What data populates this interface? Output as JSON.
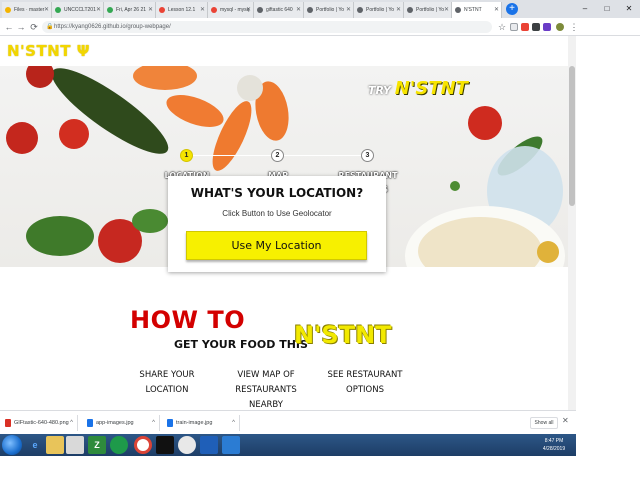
{
  "browser": {
    "tabs": [
      {
        "label": "Files · master",
        "color": "#f4b400"
      },
      {
        "label": "UNCCCLT201",
        "color": "#34a853"
      },
      {
        "label": "Fri, Apr 26 21",
        "color": "#34a853"
      },
      {
        "label": "Lesson 12.1",
        "color": "#ea4335"
      },
      {
        "label": "mysql - mysq",
        "color": "#ea4335"
      },
      {
        "label": "giftastic 640",
        "color": "#5f6368"
      },
      {
        "label": "Portfolio | Yo",
        "color": "#5f6368"
      },
      {
        "label": "Portfolio | Yo",
        "color": "#5f6368"
      },
      {
        "label": "Portfolio | Yo",
        "color": "#5f6368"
      },
      {
        "label": "N'STNT",
        "color": "#5f6368"
      }
    ],
    "new_tab_label": "+",
    "url": "https://kyang0626.github.io/group-webpage/",
    "window_controls": {
      "minimize": "–",
      "maximize": "□",
      "close": "✕"
    }
  },
  "site": {
    "logo": "N'STNT",
    "hero": {
      "try_word": "TRY",
      "brand": "N'STNT",
      "steps": [
        {
          "number": "1",
          "label": "LOCATION"
        },
        {
          "number": "2",
          "label": "MAP"
        },
        {
          "number": "3",
          "label": "RESTAURANT\nOPTIONS"
        }
      ],
      "card": {
        "title": "WHAT'S YOUR LOCATION?",
        "subtitle": "Click Button to Use Geolocator",
        "button": "Use My Location"
      }
    },
    "howto": {
      "heading": "HOW TO",
      "subheading": "GET YOUR FOOD THIS",
      "brand": "N'STNT",
      "columns": [
        "SHARE YOUR\nLOCATION",
        "VIEW MAP OF\nRESTAURANTS\nNEARBY",
        "SEE RESTAURANT\nOPTIONS"
      ]
    }
  },
  "downloads": {
    "items": [
      {
        "label": "GIFtastic-640-480.png"
      },
      {
        "label": "app-images.jpg"
      },
      {
        "label": "train-image.jpg"
      }
    ],
    "show_all": "Show all",
    "close": "✕"
  },
  "taskbar": {
    "clock_time": "8:47 PM",
    "clock_date": "4/28/2019"
  },
  "colors": {
    "brand_yellow": "#f2e900",
    "howto_red": "#d30000",
    "button_yellow": "#f7f000"
  }
}
